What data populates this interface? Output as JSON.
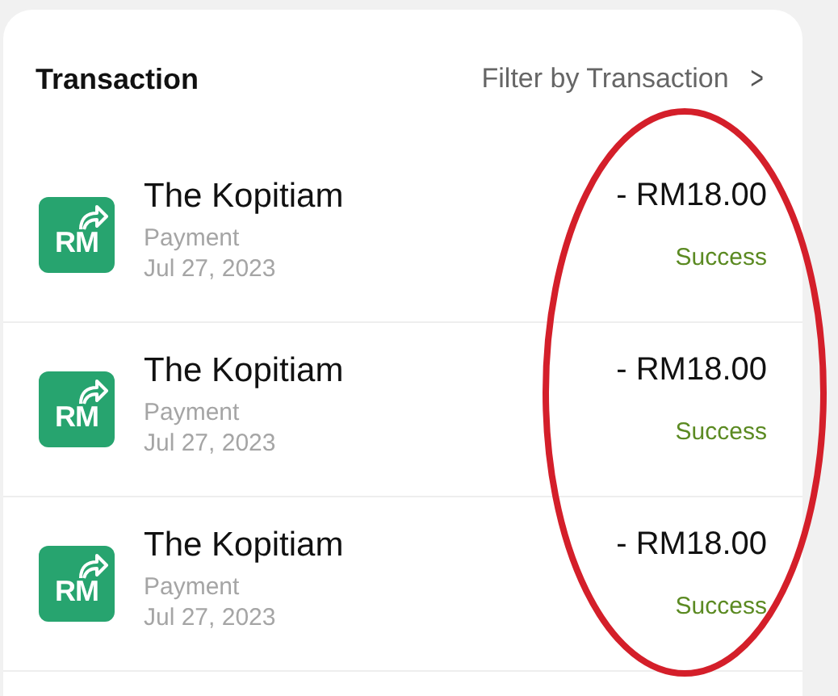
{
  "header": {
    "title": "Transaction",
    "filter_label": "Filter by Transaction",
    "filter_chevron": ">"
  },
  "transactions": [
    {
      "logo_text": "RM",
      "merchant": "The Kopitiam",
      "type": "Payment",
      "date": "Jul 27, 2023",
      "amount": "- RM18.00",
      "status": "Success"
    },
    {
      "logo_text": "RM",
      "merchant": "The Kopitiam",
      "type": "Payment",
      "date": "Jul 27, 2023",
      "amount": "- RM18.00",
      "status": "Success"
    },
    {
      "logo_text": "RM",
      "merchant": "The Kopitiam",
      "type": "Payment",
      "date": "Jul 27, 2023",
      "amount": "- RM18.00",
      "status": "Success"
    }
  ],
  "annotation": {
    "kind": "ellipse"
  }
}
